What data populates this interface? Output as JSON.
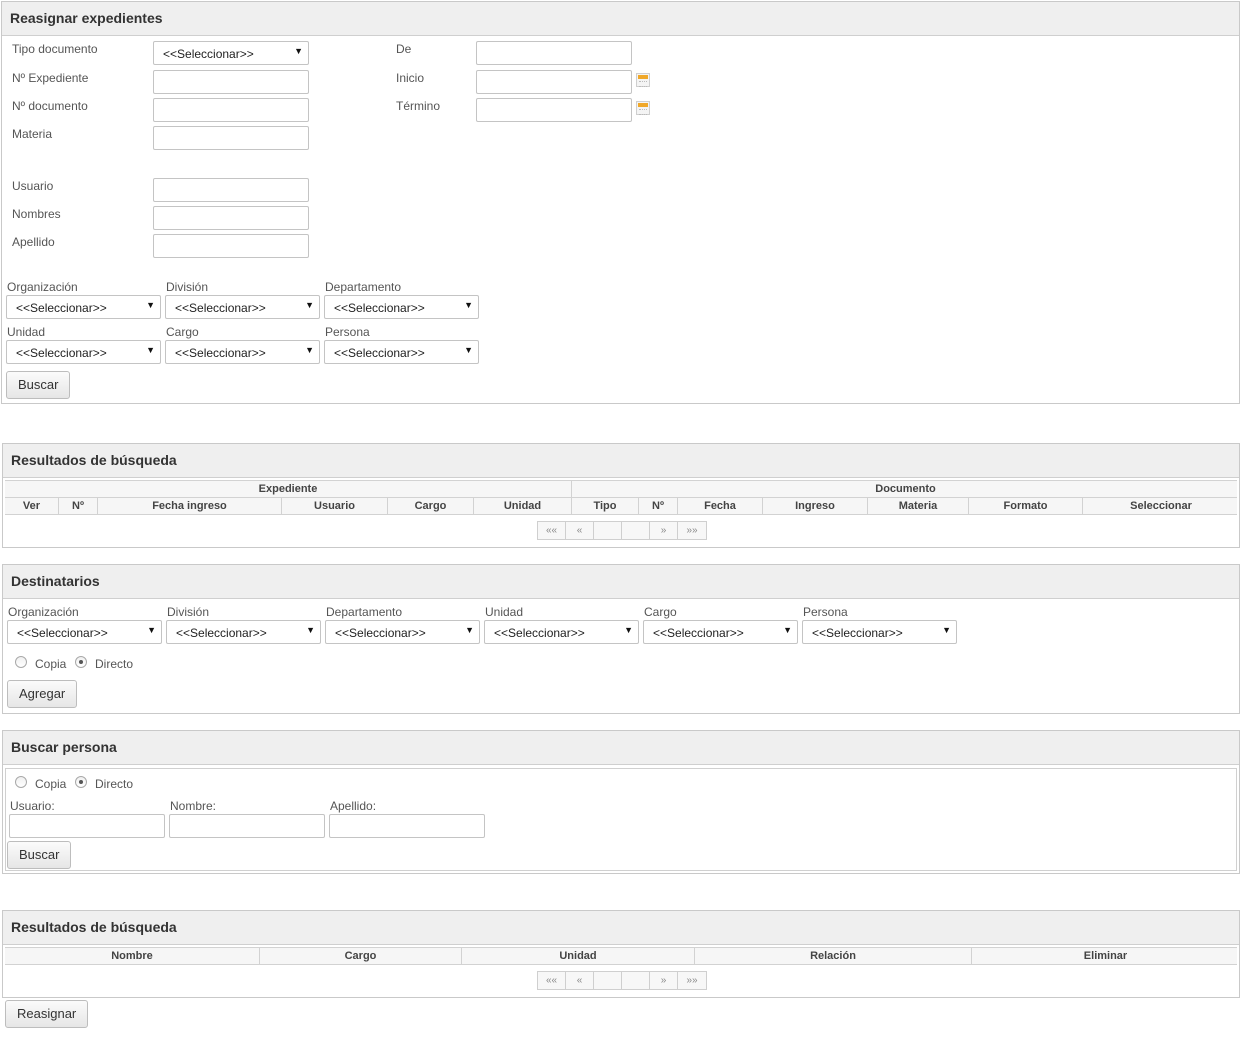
{
  "reassign": {
    "title": "Reasignar expedientes",
    "select_placeholder": "<<Seleccionar>>",
    "labels": {
      "tipo_documento": "Tipo documento",
      "n_expediente": "Nº Expediente",
      "n_documento": "Nº documento",
      "materia": "Materia",
      "de": "De",
      "inicio": "Inicio",
      "termino": "Término",
      "usuario": "Usuario",
      "nombres": "Nombres",
      "apellido": "Apellido",
      "organizacion": "Organización",
      "division": "División",
      "departamento": "Departamento",
      "unidad": "Unidad",
      "cargo": "Cargo",
      "persona": "Persona"
    },
    "search_button": "Buscar"
  },
  "results1": {
    "title": "Resultados de búsqueda",
    "group_expediente": "Expediente",
    "group_documento": "Documento",
    "columns": [
      "Ver",
      "Nº",
      "Fecha ingreso",
      "Usuario",
      "Cargo",
      "Unidad",
      "Tipo",
      "Nº",
      "Fecha",
      "Ingreso",
      "Materia",
      "Formato",
      "Seleccionar"
    ],
    "pager": [
      "««",
      "«",
      "",
      "",
      "»",
      "»»"
    ]
  },
  "recipients": {
    "title": "Destinatarios",
    "labels": [
      "Organización",
      "División",
      "Departamento",
      "Unidad",
      "Cargo",
      "Persona"
    ],
    "select_placeholder": "<<Seleccionar>>",
    "radio_copy": "Copia",
    "radio_direct": "Directo",
    "selected_radio": "Directo",
    "add_button": "Agregar"
  },
  "person_search": {
    "title": "Buscar persona",
    "radio_copy": "Copia",
    "radio_direct": "Directo",
    "selected_radio": "Directo",
    "usuario_label": "Usuario:",
    "nombre_label": "Nombre:",
    "apellido_label": "Apellido:",
    "search_button": "Buscar"
  },
  "results2": {
    "title": "Resultados de búsqueda",
    "columns": [
      "Nombre",
      "Cargo",
      "Unidad",
      "Relación",
      "Eliminar"
    ],
    "pager": [
      "««",
      "«",
      "",
      "",
      "»",
      "»»"
    ]
  },
  "reassign_button": "Reasignar"
}
